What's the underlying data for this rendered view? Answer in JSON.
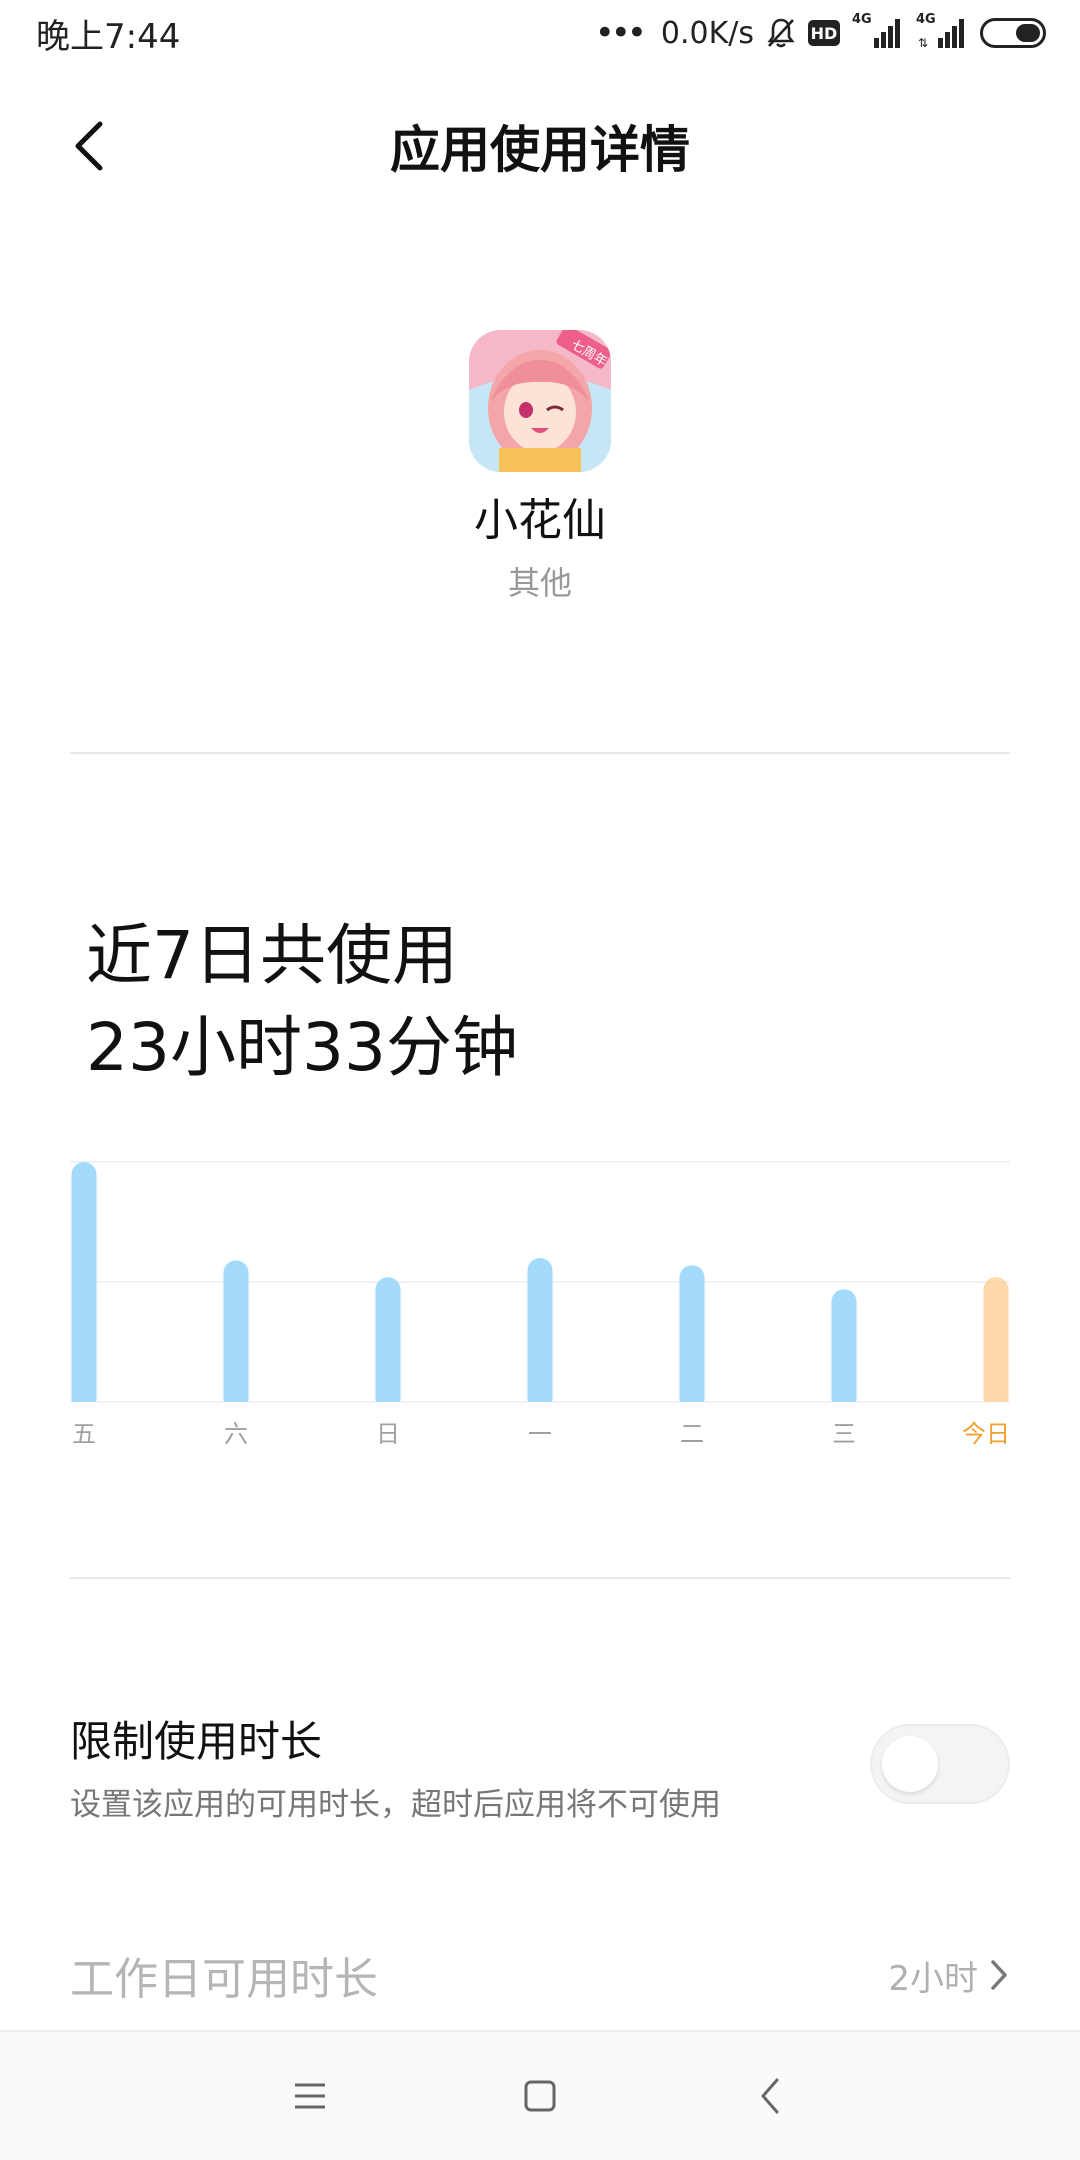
{
  "status_bar": {
    "time": "晚上7:44",
    "network_speed": "0.0K/s",
    "hd_label": "HD",
    "sim1_label": "4G",
    "sim2_label": "4G"
  },
  "header": {
    "title": "应用使用详情",
    "back_icon": "chevron-left-icon"
  },
  "app": {
    "name": "小花仙",
    "category": "其他",
    "icon_badge_text": "七周年"
  },
  "usage": {
    "line1": "近7日共使用",
    "line2": "23小时33分钟"
  },
  "chart_data": {
    "type": "bar",
    "categories": [
      "五",
      "六",
      "日",
      "一",
      "二",
      "三",
      "今日"
    ],
    "values": [
      1.0,
      0.59,
      0.52,
      0.6,
      0.57,
      0.47,
      0.52
    ],
    "highlight_index": 6,
    "colors": {
      "bar": "#a3daf9",
      "today_bar": "#fdd8a8",
      "today_label": "#f0a030",
      "label": "#a0a0a0",
      "grid": "#f2f2f2"
    },
    "gridlines": 3,
    "title": "",
    "xlabel": "",
    "ylabel": ""
  },
  "limit": {
    "title": "限制使用时长",
    "description": "设置该应用的可用时长，超时后应用将不可使用",
    "enabled": false
  },
  "workday": {
    "label": "工作日可用时长",
    "value": "2小时"
  },
  "nav": {
    "menu_icon": "menu-icon",
    "home_icon": "home-icon",
    "back_icon": "back-icon"
  }
}
